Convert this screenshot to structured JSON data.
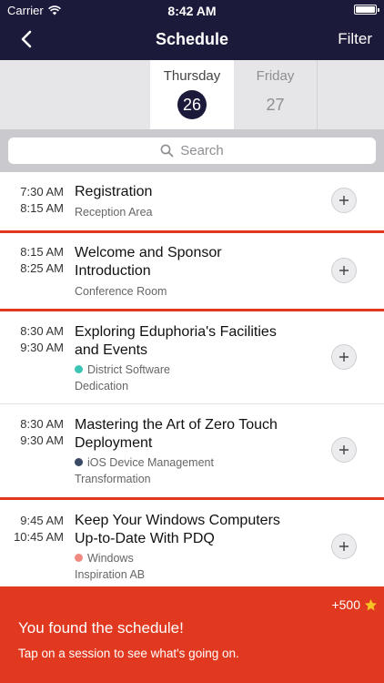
{
  "status_bar": {
    "carrier": "Carrier",
    "time": "8:42 AM"
  },
  "nav": {
    "title": "Schedule",
    "filter_label": "Filter"
  },
  "days": {
    "selected": {
      "name": "Thursday",
      "number": "26"
    },
    "other": {
      "name": "Friday",
      "number": "27"
    }
  },
  "search": {
    "placeholder": "Search"
  },
  "sessions": [
    {
      "start": "7:30 AM",
      "end": "8:15 AM",
      "title_lines": [
        "Registration"
      ],
      "location": "Reception Area",
      "track": "",
      "track_color": ""
    },
    {
      "start": "8:15 AM",
      "end": "8:25 AM",
      "title_lines": [
        "Welcome and Sponsor",
        "Introduction"
      ],
      "location": "Conference Room",
      "track": "",
      "track_color": ""
    },
    {
      "start": "8:30 AM",
      "end": "9:30 AM",
      "title_lines": [
        "Exploring Eduphoria's Facilities",
        "and Events"
      ],
      "track": "District Software",
      "track_color": "#3cc4b4",
      "location": "Dedication"
    },
    {
      "start": "8:30 AM",
      "end": "9:30 AM",
      "title_lines": [
        "Mastering the Art of Zero Touch",
        "Deployment"
      ],
      "track": "iOS Device Management",
      "track_color": "#3a4a64",
      "location": "Transformation"
    },
    {
      "start": "9:45 AM",
      "end": "10:45 AM",
      "title_lines": [
        "Keep Your Windows Computers",
        "Up-to-Date With PDQ"
      ],
      "track": "Windows",
      "track_color": "#f08a80",
      "location": "Inspiration AB"
    }
  ],
  "toast": {
    "points": "+500",
    "title": "You found the schedule!",
    "body": "Tap on a session to see what's going on."
  },
  "colors": {
    "nav": "#1c1a3a",
    "accent": "#e0391f"
  }
}
